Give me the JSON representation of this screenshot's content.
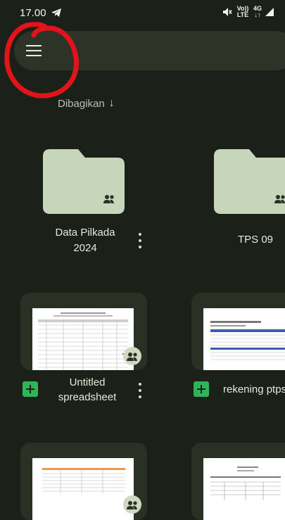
{
  "status_bar": {
    "time": "17.00",
    "network_volte": "Vo)) LTE",
    "network_type": "4G"
  },
  "search": {
    "placeholder": ""
  },
  "section": {
    "title": "Dibagikan",
    "sort_icon": "arrow-down-icon"
  },
  "folders": [
    {
      "name": "Data Pilkada 2024",
      "line1": "Data Pilkada",
      "line2": "2024",
      "shared": true
    },
    {
      "name": "TPS 09",
      "shared": true
    }
  ],
  "files": [
    {
      "line1": "Untitled",
      "line2": "spreadsheet",
      "type": "spreadsheet",
      "shared": true
    },
    {
      "name": "rekening ptps",
      "type": "spreadsheet",
      "shared": true
    },
    {
      "type": "spreadsheet",
      "shared": true
    },
    {
      "type": "document",
      "shared": true
    }
  ],
  "colors": {
    "background": "#1b2118",
    "folder": "#c7d5bb",
    "card": "#2a3024",
    "sheets_green": "#2fb45a",
    "annotation_red": "#e0141a"
  }
}
